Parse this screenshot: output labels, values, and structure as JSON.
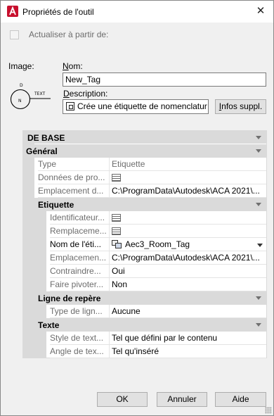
{
  "window": {
    "title": "Propriétés de l'outil",
    "close_glyph": "✕"
  },
  "refresh": {
    "label": "Actualiser à partir de:",
    "checked": false
  },
  "image": {
    "label": "Image:",
    "preview_tag_text": "TEXT",
    "preview_small": "D",
    "preview_center": "N"
  },
  "name": {
    "label": "Nom:",
    "value": "New_Tag"
  },
  "description": {
    "label": "Description:",
    "value": "Crée une étiquette de nomenclatur"
  },
  "more_info_button": "Infos suppl.",
  "grid": {
    "category": "DE BASE",
    "sections": [
      {
        "label": "Général",
        "rows": [
          {
            "name": "Type",
            "value": "Etiquette"
          },
          {
            "name": "Données de pro...",
            "value": ""
          },
          {
            "name": "Emplacement d...",
            "value": "C:\\ProgramData\\Autodesk\\ACA  2021\\..."
          }
        ]
      },
      {
        "label": "Etiquette",
        "rows": [
          {
            "name": "Identificateur...",
            "value": ""
          },
          {
            "name": "Remplaceme...",
            "value": ""
          },
          {
            "name": "Nom de l'éti...",
            "value": "Aec3_Room_Tag"
          },
          {
            "name": "Emplacemen...",
            "value": "C:\\ProgramData\\Autodesk\\ACA  2021\\..."
          },
          {
            "name": "Contraindre...",
            "value": "Oui"
          },
          {
            "name": "Faire pivoter...",
            "value": "Non"
          }
        ]
      },
      {
        "label": "Ligne de repère",
        "rows": [
          {
            "name": "Type de lign...",
            "value": "Aucune"
          }
        ]
      },
      {
        "label": "Texte",
        "rows": [
          {
            "name": "Style de text...",
            "value": "Tel que défini par le contenu"
          },
          {
            "name": "Angle de tex...",
            "value": "Tel qu'inséré"
          }
        ]
      }
    ]
  },
  "buttons": {
    "ok": "OK",
    "cancel": "Annuler",
    "help": "Aide"
  }
}
